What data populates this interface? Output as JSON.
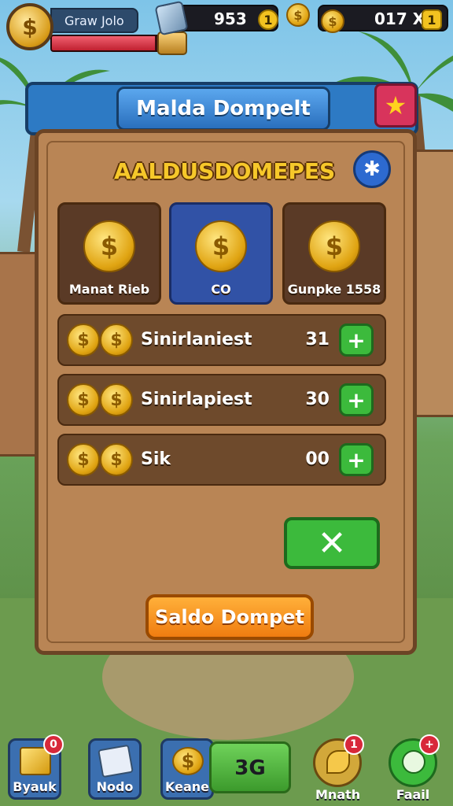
{
  "colors": {
    "accent_blue": "#2d7ac4",
    "panel_wood": "#b98555",
    "action_green": "#3cba3c",
    "cta_orange": "#f07c10",
    "heading_gold": "#f6c82a"
  },
  "hud": {
    "player_name": "Graw Jolo",
    "xp_progress": 0.9,
    "resource1_value": "953",
    "resource1_icon": "gem-icon",
    "resource2_value": "017 X",
    "coin_symbol": "$",
    "plus_symbol": "1"
  },
  "modal": {
    "title": "Malda Dompelt",
    "star_icon": "★",
    "heading": "AALDUSDOMEPES",
    "settings_icon": "✱",
    "cards": [
      {
        "label": "Manat Rieb",
        "coin_symbol": "$"
      },
      {
        "label": "CO",
        "coin_symbol": "$"
      },
      {
        "label": "Gunpke 1558",
        "coin_symbol": "$"
      }
    ],
    "rows": [
      {
        "name": "Sinirlaniest",
        "qty": "31",
        "add_icon": "+"
      },
      {
        "name": "Sinirlapiest",
        "qty": "30",
        "add_icon": "+"
      },
      {
        "name": "Sik",
        "qty": "00",
        "add_icon": "+"
      }
    ],
    "close_icon": "✕",
    "confirm_label": "Saldo Dompet"
  },
  "bottom_nav": {
    "bank_label": "Byauk",
    "bank_badge": "0",
    "mode_label": "Nodo",
    "kane_label": "Keane",
    "balance_value": "3G",
    "mnth_label": "Mnath",
    "mnth_badge": "1",
    "food_label": "Faail",
    "food_badge": "+"
  }
}
